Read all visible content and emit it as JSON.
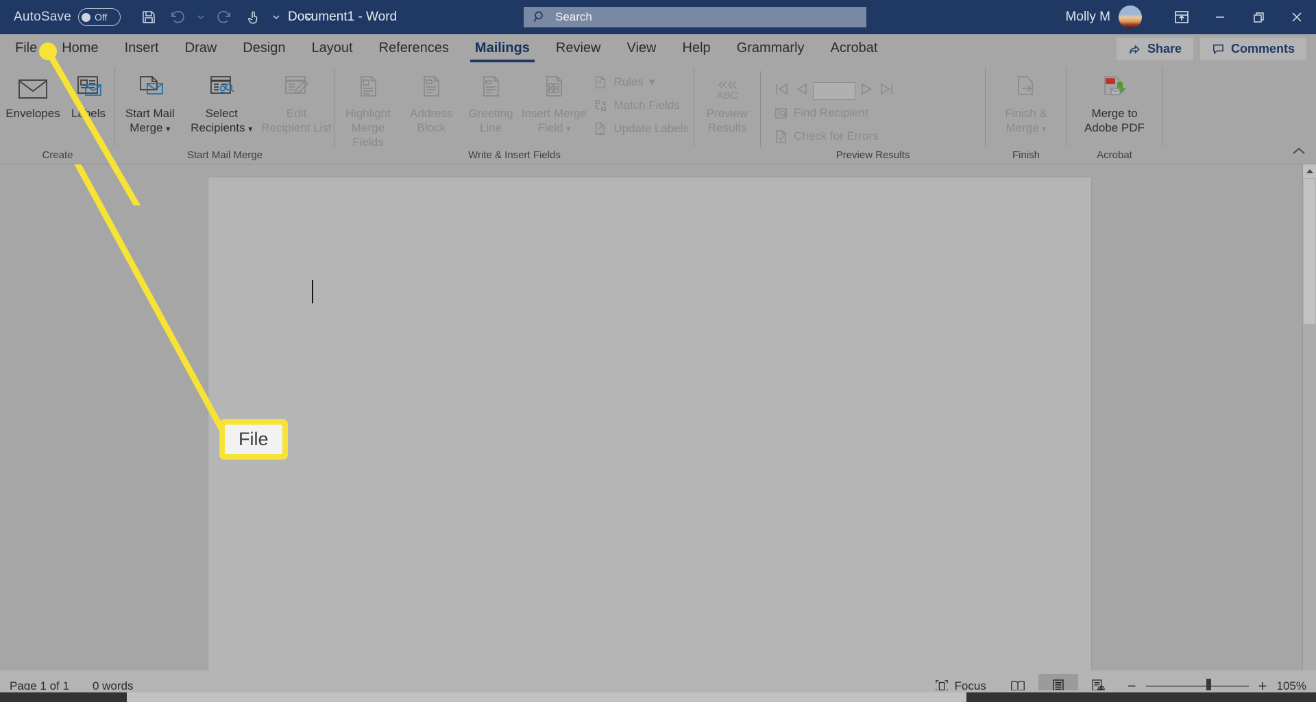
{
  "titlebar": {
    "autosave_label": "AutoSave",
    "autosave_state": "Off",
    "document_title": "Document1  -  Word",
    "search_placeholder": "Search",
    "username": "Molly M",
    "quick_access": [
      {
        "name": "save-icon",
        "label": "Save"
      },
      {
        "name": "undo-icon",
        "label": "Undo"
      },
      {
        "name": "undo-dropdown-icon",
        "label": "Undo options"
      },
      {
        "name": "redo-icon",
        "label": "Redo"
      },
      {
        "name": "touch-mode-icon",
        "label": "Touch/Mouse Mode"
      },
      {
        "name": "touch-dropdown-icon",
        "label": "Touch mode options"
      },
      {
        "name": "customize-qat-icon",
        "label": "Customize Quick Access Toolbar"
      }
    ],
    "window_controls": [
      {
        "name": "ribbon-display-options-icon",
        "label": "Ribbon Display Options"
      },
      {
        "name": "minimize-icon",
        "label": "Minimize"
      },
      {
        "name": "restore-icon",
        "label": "Restore Down"
      },
      {
        "name": "close-icon",
        "label": "Close"
      }
    ]
  },
  "tabs": [
    {
      "label": "File",
      "active": false
    },
    {
      "label": "Home",
      "active": false
    },
    {
      "label": "Insert",
      "active": false
    },
    {
      "label": "Draw",
      "active": false
    },
    {
      "label": "Design",
      "active": false
    },
    {
      "label": "Layout",
      "active": false
    },
    {
      "label": "References",
      "active": false
    },
    {
      "label": "Mailings",
      "active": true
    },
    {
      "label": "Review",
      "active": false
    },
    {
      "label": "View",
      "active": false
    },
    {
      "label": "Help",
      "active": false
    },
    {
      "label": "Grammarly",
      "active": false
    },
    {
      "label": "Acrobat",
      "active": false
    }
  ],
  "tab_actions": {
    "share_label": "Share",
    "comments_label": "Comments"
  },
  "ribbon": {
    "collapse_label": "Collapse the Ribbon",
    "groups": [
      {
        "name": "Create",
        "buttons": [
          {
            "label_line1": "Envelopes",
            "label_line2": "",
            "icon": "envelope-icon",
            "dimmed": false
          },
          {
            "label_line1": "Labels",
            "label_line2": "",
            "icon": "labels-icon",
            "dimmed": false
          }
        ]
      },
      {
        "name": "Start Mail Merge",
        "buttons": [
          {
            "label_line1": "Start Mail",
            "label_line2": "Merge",
            "icon": "start-mail-merge-icon",
            "dimmed": false,
            "dropdown": true
          },
          {
            "label_line1": "Select",
            "label_line2": "Recipients",
            "icon": "select-recipients-icon",
            "dimmed": false,
            "dropdown": true
          },
          {
            "label_line1": "Edit",
            "label_line2": "Recipient List",
            "icon": "edit-recipient-list-icon",
            "dimmed": true
          }
        ]
      },
      {
        "name": "Write & Insert Fields",
        "buttons": [
          {
            "label_line1": "Highlight",
            "label_line2": "Merge Fields",
            "icon": "highlight-merge-fields-icon",
            "dimmed": true
          },
          {
            "label_line1": "Address",
            "label_line2": "Block",
            "icon": "address-block-icon",
            "dimmed": true
          },
          {
            "label_line1": "Greeting",
            "label_line2": "Line",
            "icon": "greeting-line-icon",
            "dimmed": true
          },
          {
            "label_line1": "Insert Merge",
            "label_line2": "Field",
            "icon": "insert-merge-field-icon",
            "dimmed": true,
            "dropdown": true
          }
        ],
        "small_buttons": [
          {
            "label": "Rules",
            "icon": "rules-icon",
            "dropdown": true
          },
          {
            "label": "Match Fields",
            "icon": "match-fields-icon",
            "dropdown": false
          },
          {
            "label": "Update Labels",
            "icon": "update-labels-icon",
            "dropdown": false
          }
        ]
      },
      {
        "name": "Preview Results",
        "buttons": [
          {
            "label_line1": "Preview",
            "label_line2": "Results",
            "icon": "preview-results-abc-icon",
            "dimmed": true,
            "top_text": "ABC"
          }
        ],
        "nav_buttons": [
          {
            "name": "first-record-icon",
            "label": "First Record"
          },
          {
            "name": "previous-record-icon",
            "label": "Previous Record"
          },
          {
            "name": "record-number-field",
            "label": ""
          },
          {
            "name": "next-record-icon",
            "label": "Next Record"
          },
          {
            "name": "last-record-icon",
            "label": "Last Record"
          }
        ],
        "small_buttons": [
          {
            "label": "Find Recipient",
            "icon": "find-recipient-icon",
            "dropdown": false
          },
          {
            "label": "Check for Errors",
            "icon": "check-for-errors-icon",
            "dropdown": false
          }
        ]
      },
      {
        "name": "Finish",
        "buttons": [
          {
            "label_line1": "Finish &",
            "label_line2": "Merge",
            "icon": "finish-and-merge-icon",
            "dimmed": true,
            "dropdown": true
          }
        ]
      },
      {
        "name": "Acrobat",
        "buttons": [
          {
            "label_line1": "Merge to",
            "label_line2": "Adobe PDF",
            "icon": "merge-to-adobe-pdf-icon",
            "dimmed": false
          }
        ]
      }
    ]
  },
  "annotation": {
    "callout_text": "File",
    "highlight_color": "#f6e335"
  },
  "statusbar": {
    "page_info": "Page 1 of 1",
    "word_count": "0 words",
    "focus_label": "Focus",
    "view_buttons": [
      {
        "name": "read-mode-icon",
        "label": "Read Mode",
        "active": false
      },
      {
        "name": "print-layout-icon",
        "label": "Print Layout",
        "active": true
      },
      {
        "name": "web-layout-icon",
        "label": "Web Layout",
        "active": false
      }
    ],
    "zoom_out_label": "−",
    "zoom_in_label": "+",
    "zoom_value": "105%"
  }
}
